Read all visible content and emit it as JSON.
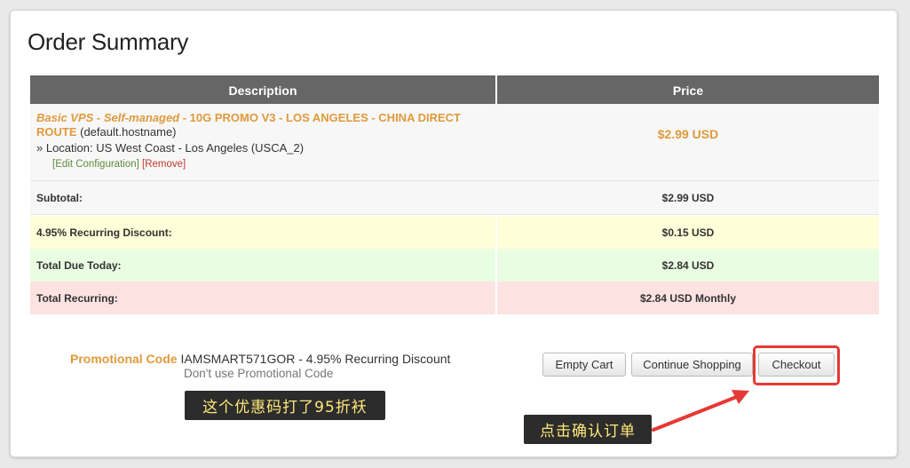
{
  "page": {
    "title": "Order Summary"
  },
  "table": {
    "headers": {
      "description": "Description",
      "price": "Price"
    },
    "item": {
      "product_group": "Basic VPS - Self-managed",
      "product_name": " - 10G PROMO V3 - LOS ANGELES - CHINA DIRECT ROUTE",
      "hostname": " (default.hostname)",
      "location": "» Location: US West Coast - Los Angeles (USCA_2)",
      "edit_label": "[Edit Configuration]",
      "remove_label": "[Remove]",
      "price": "$2.99 USD"
    },
    "subtotal": {
      "label": "Subtotal:",
      "value": "$2.99 USD"
    },
    "discount": {
      "label": "4.95% Recurring Discount:",
      "value": "$0.15 USD"
    },
    "total_due": {
      "label": "Total Due Today:",
      "value": "$2.84 USD"
    },
    "total_recurring": {
      "label": "Total Recurring:",
      "value": "$2.84 USD Monthly"
    }
  },
  "promo": {
    "label": "Promotional Code",
    "value": " IAMSMART571GOR - 4.95% Recurring Discount",
    "remove_link": "Don't use Promotional Code"
  },
  "buttons": {
    "empty_cart": "Empty Cart",
    "continue_shopping": "Continue Shopping",
    "checkout": "Checkout"
  },
  "annotations": {
    "promo_note": "这个优惠码打了95折袄",
    "checkout_note": "点击确认订单"
  },
  "colors": {
    "accent_orange": "#e09a3c",
    "header_gray": "#666666",
    "discount_bg": "#fefed8",
    "due_bg": "#e9fde3",
    "recurring_bg": "#fde2e2",
    "highlight_red": "#e53935",
    "note_text": "#ffe97a"
  }
}
